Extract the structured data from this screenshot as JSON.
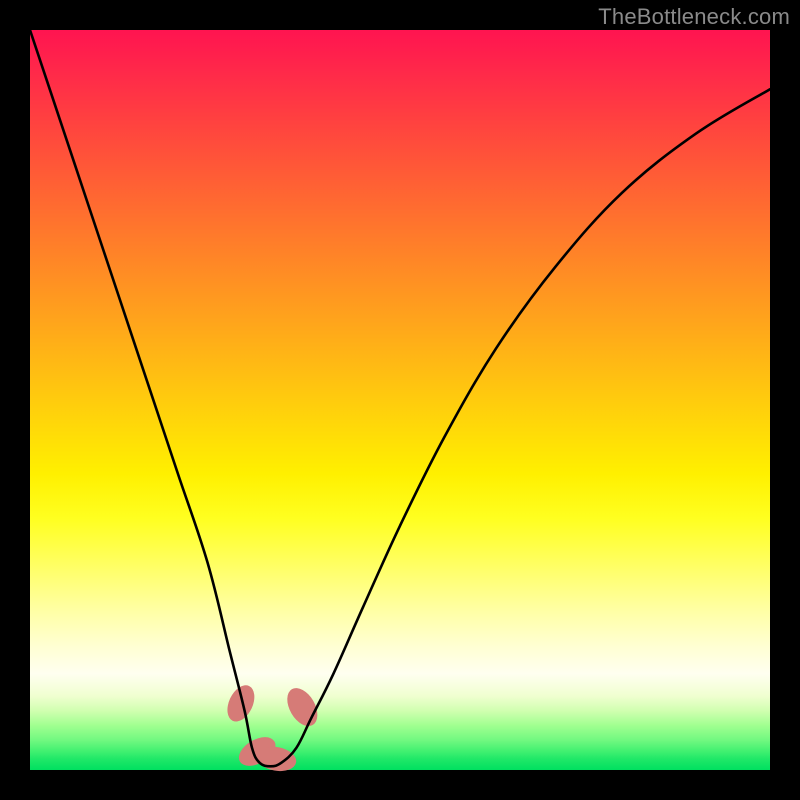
{
  "watermark": "TheBottleneck.com",
  "chart_data": {
    "type": "line",
    "title": "",
    "xlabel": "",
    "ylabel": "",
    "xlim": [
      0,
      100
    ],
    "ylim": [
      0,
      100
    ],
    "series": [
      {
        "name": "bottleneck-curve",
        "x": [
          0,
          4,
          8,
          12,
          16,
          20,
          24,
          27,
          29,
          30,
          31,
          32.5,
          34,
          36,
          38,
          41,
          45,
          50,
          56,
          63,
          71,
          80,
          90,
          100
        ],
        "y": [
          100,
          88,
          76,
          64,
          52,
          40,
          28,
          16,
          8,
          3,
          1,
          0.5,
          1,
          3,
          7,
          13,
          22,
          33,
          45,
          57,
          68,
          78,
          86,
          92
        ]
      }
    ],
    "markers": [
      {
        "cx": 28.5,
        "cy": 9,
        "rx": 1.6,
        "ry": 2.6,
        "rot": 25
      },
      {
        "cx": 30.7,
        "cy": 2.5,
        "rx": 1.6,
        "ry": 2.7,
        "rot": 60
      },
      {
        "cx": 33.3,
        "cy": 1.5,
        "rx": 1.6,
        "ry": 2.7,
        "rot": 100
      },
      {
        "cx": 36.8,
        "cy": 8.5,
        "rx": 1.7,
        "ry": 2.8,
        "rot": -30
      }
    ],
    "colors": {
      "curve": "#000000",
      "marker": "#d67b77"
    }
  }
}
